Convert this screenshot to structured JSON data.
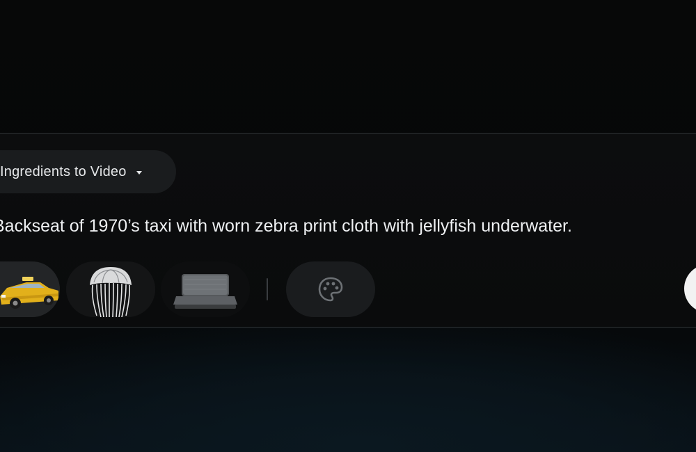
{
  "composer": {
    "mode_label": "Ingredients to Video",
    "prompt_text": "Backseat of 1970’s taxi with worn zebra print cloth with jellyfish underwater."
  },
  "ingredients": [
    {
      "name": "yellow-taxi",
      "icon": "taxi-image"
    },
    {
      "name": "jellyfish",
      "icon": "jellyfish-image"
    },
    {
      "name": "car-seat",
      "icon": "seat-image"
    }
  ],
  "icons": {
    "mode_dropdown": "chevron-down-icon",
    "style": "palette-icon"
  },
  "colors": {
    "background": "#050607",
    "panel": "#0b0c0d",
    "chip": "#1a1c1e",
    "text": "#eef0f2",
    "taxi_yellow": "#e7b51c"
  }
}
